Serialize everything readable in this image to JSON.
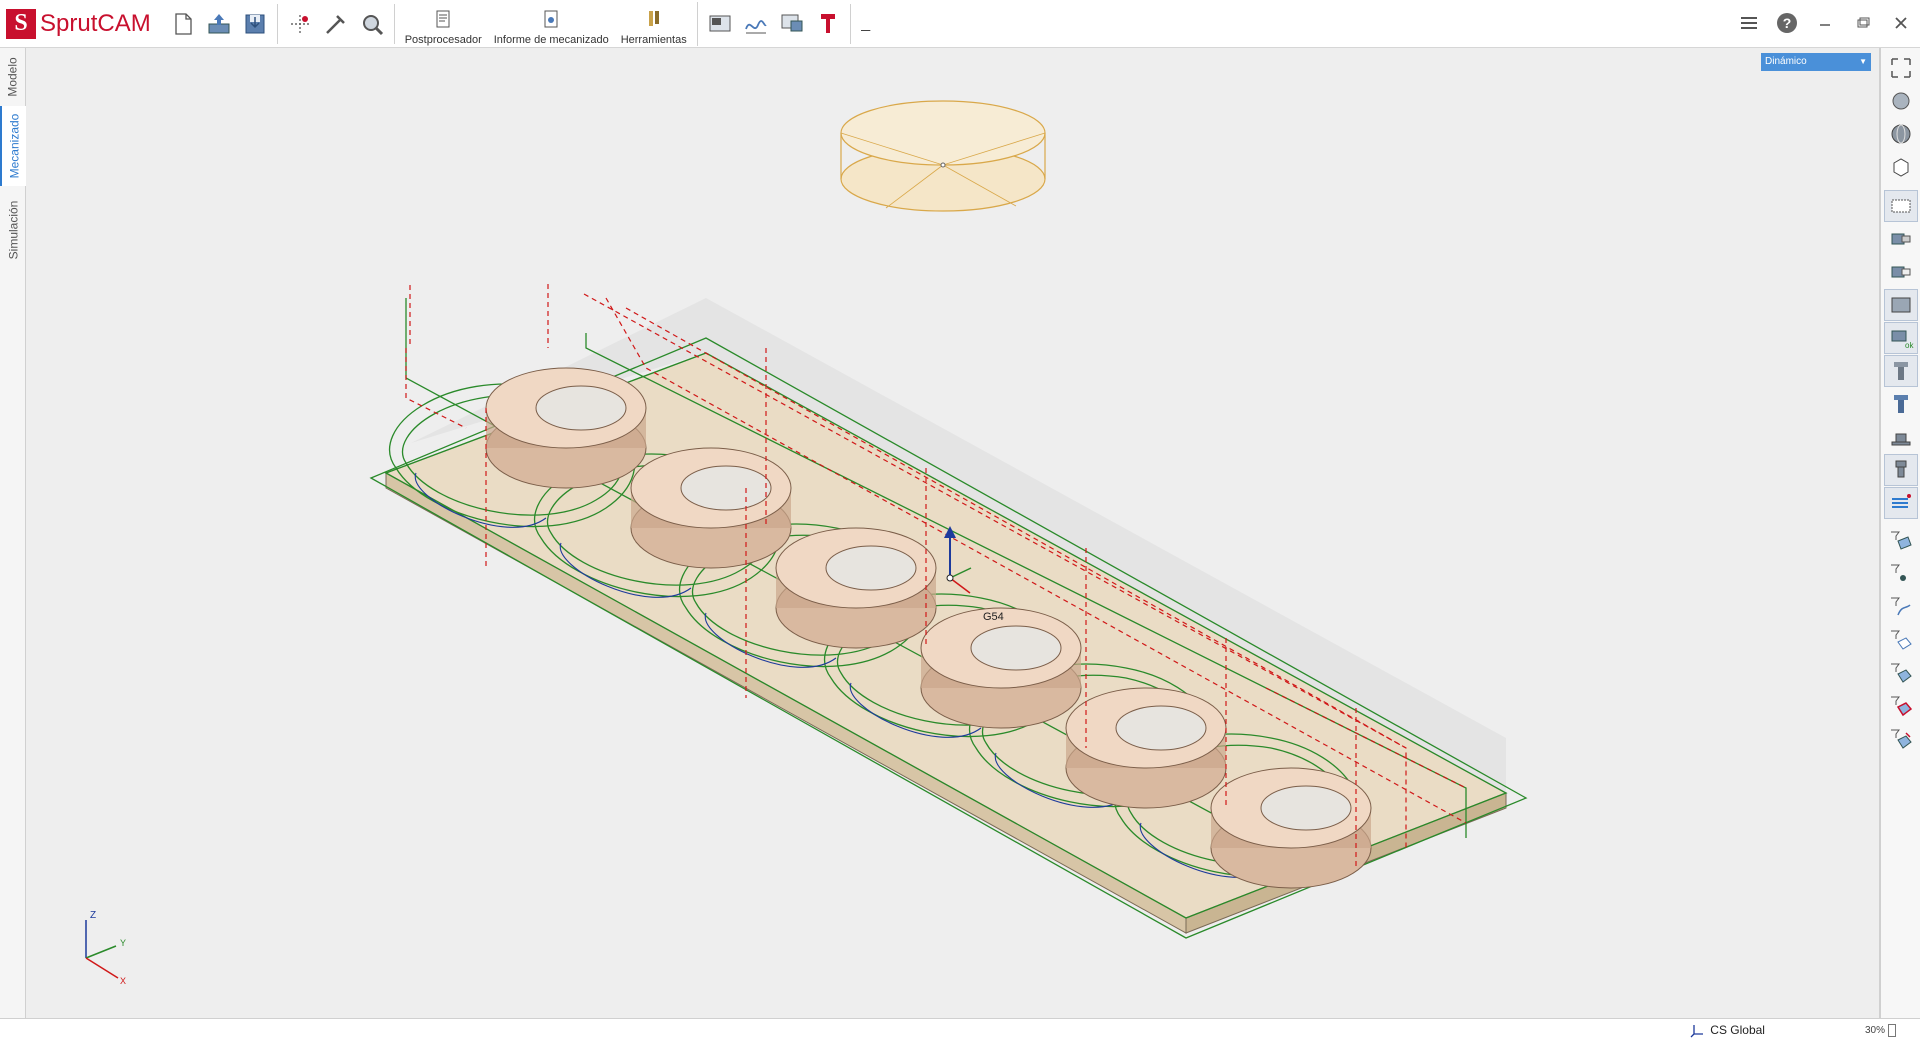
{
  "app": {
    "logo_text": "SprutCAM",
    "brand_color": "#c8102e"
  },
  "toolbar": {
    "buttons_left": [
      "new-file-icon",
      "open-file-icon",
      "save-icon"
    ],
    "buttons_tools": [
      "axes-icon",
      "measure-icon",
      "inspect-icon"
    ],
    "postprocessor_label": "Postprocesador",
    "report_label": "Informe de mecanizado",
    "tools_label": "Herramientas",
    "buttons_view": [
      "machine-panel-icon",
      "chart-icon",
      "screen-icon",
      "tool-red-icon"
    ],
    "dash": "_"
  },
  "left_tabs": [
    {
      "label": "Modelo",
      "active": false
    },
    {
      "label": "Mecanizado",
      "active": true
    },
    {
      "label": "Simulación",
      "active": false
    }
  ],
  "viewport": {
    "view_mode": "Dinámico",
    "origin_label": "G54",
    "axes": {
      "z": "Z",
      "y": "Y",
      "x": "X"
    }
  },
  "right_tools": [
    "zoom-fit-icon",
    "rotate-icon",
    "sphere-icon",
    "cube-icon",
    "section-view-icon",
    "part-view-icon",
    "part-view-alt-icon",
    "workpiece-icon",
    "ok-check-icon",
    "tool-holder-icon",
    "tool-holder-alt-icon",
    "fixture-icon",
    "clamp-icon",
    "toolpath-list-icon",
    "filter-surface-icon",
    "filter-point-icon",
    "filter-curve-icon",
    "filter-face-icon",
    "filter-solid-icon",
    "filter-red-icon",
    "filter-all-icon"
  ],
  "statusbar": {
    "cs_label": "CS Global",
    "zoom": "30%"
  }
}
